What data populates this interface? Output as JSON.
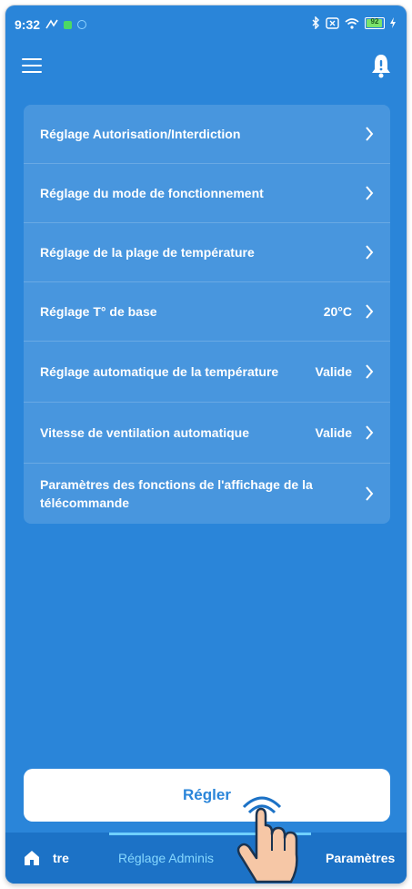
{
  "status_bar": {
    "time": "9:32",
    "battery_level": "92",
    "icons": [
      "notification-icon",
      "app-icon",
      "location-icon",
      "bluetooth-icon",
      "screen-icon",
      "wifi-icon",
      "battery-icon",
      "charging-icon"
    ]
  },
  "header": {
    "menu_icon": "hamburger-menu-icon",
    "bell_icon": "bell-icon"
  },
  "menu": {
    "items": [
      {
        "label": "Réglage Autorisation/Interdiction",
        "value": ""
      },
      {
        "label": "Réglage du mode de fonctionnement",
        "value": ""
      },
      {
        "label": "Réglage de la plage de température",
        "value": ""
      },
      {
        "label": "Réglage T° de base",
        "value": "20°C"
      },
      {
        "label": "Réglage automatique de la température",
        "value": "Valide"
      },
      {
        "label": "Vitesse de ventilation automatique",
        "value": "Valide"
      },
      {
        "label": "Paramètres des fonctions de l'affichage de la télécommande",
        "value": ""
      }
    ]
  },
  "apply_button": {
    "label": "Régler"
  },
  "tabs": [
    {
      "label": "tre",
      "icon": "home-icon"
    },
    {
      "label": "Réglage Adminis",
      "active": true
    },
    {
      "label": "Paramètres"
    }
  ],
  "colors": {
    "background": "#2a85d9",
    "tabbar": "#1c72c6",
    "active_tab": "#86d8ff",
    "button_text": "#2a85d9"
  }
}
